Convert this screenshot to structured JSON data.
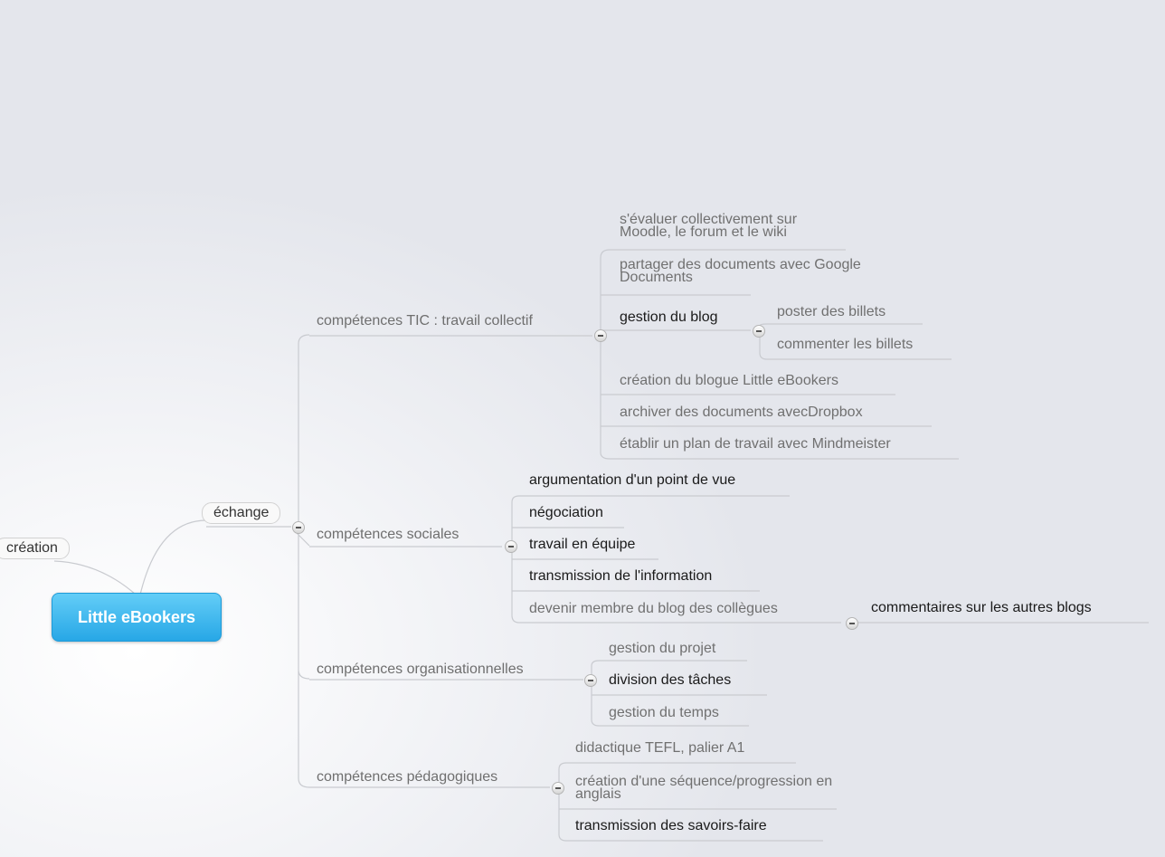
{
  "central_topic": "Little eBookers",
  "branches": {
    "creation": "création",
    "echange": "échange"
  },
  "groups": {
    "tic": {
      "label": "compétences TIC : travail collectif",
      "items": [
        "s'évaluer collectivement sur Moodle, le forum et le wiki",
        "partager des documents avec Google Documents",
        "gestion du blog",
        "création du blogue Little eBookers",
        "archiver des documents avecDropbox",
        "établir un plan de travail avec Mindmeister"
      ],
      "blog_items": [
        "poster des billets",
        "commenter les billets"
      ]
    },
    "sociales": {
      "label": "compétences sociales",
      "items": [
        "argumentation d'un point de vue",
        "négociation",
        "travail en équipe",
        "transmission de l'information",
        "devenir membre du blog des collègues"
      ],
      "membre_items": [
        "commentaires sur les autres blogs"
      ]
    },
    "organisationnelles": {
      "label": "compétences organisationnelles",
      "items": [
        "gestion du projet",
        "division des tâches",
        "gestion du temps"
      ]
    },
    "pedagogiques": {
      "label": "compétences pédagogiques",
      "items": [
        "didactique TEFL, palier A1",
        "création d'une séquence/progression en anglais",
        "transmission des savoirs-faire"
      ]
    }
  },
  "colors": {
    "root_fill": "#27a7e6",
    "connector": "#c9cbd0",
    "text_muted": "#707070",
    "text_dark": "#1a1a1a"
  }
}
